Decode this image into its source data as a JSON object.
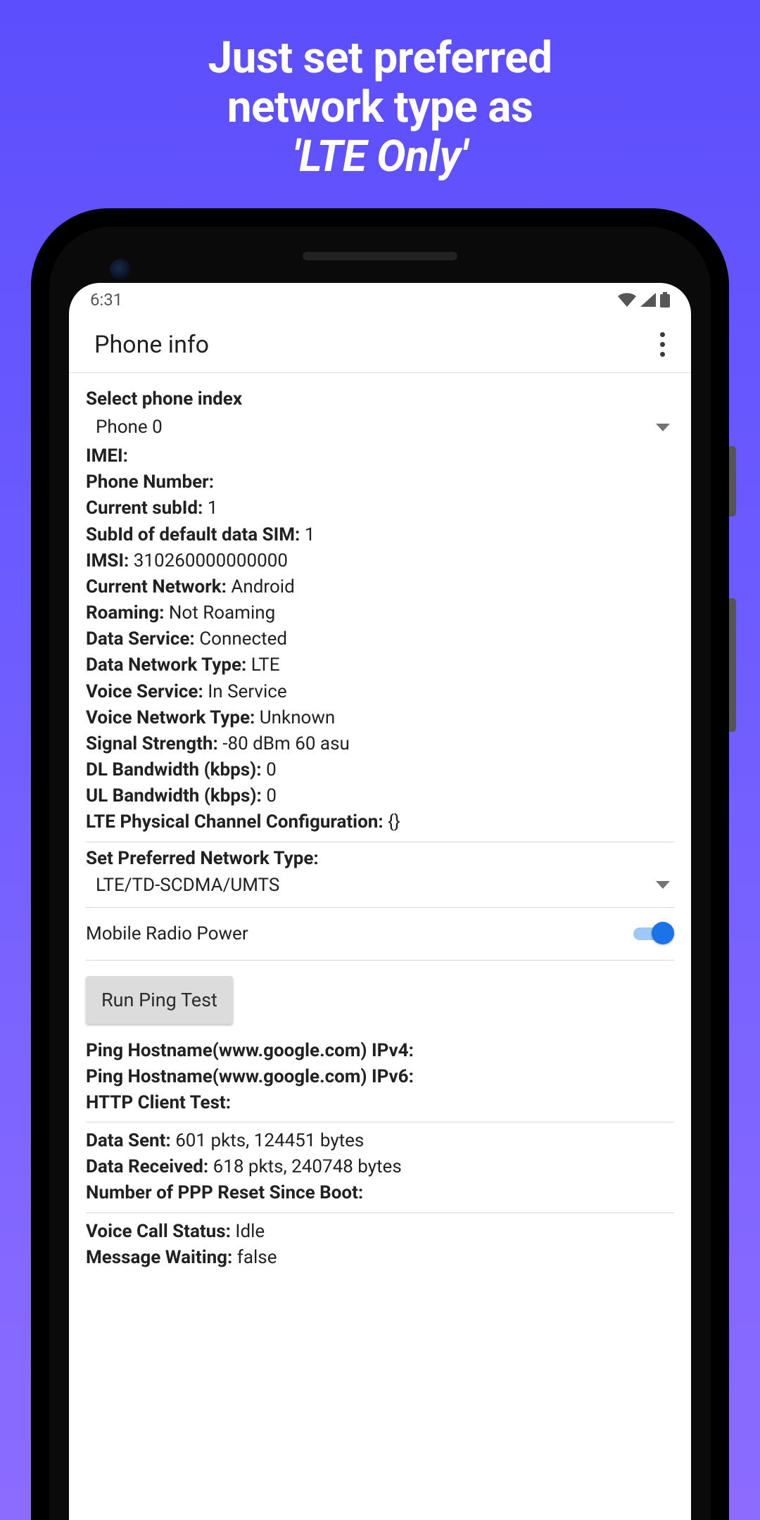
{
  "promo": {
    "line1": "Just set preferred",
    "line2": "network type as",
    "line3": "'LTE Only'"
  },
  "statusbar": {
    "time": "6:31"
  },
  "appbar": {
    "title": "Phone info"
  },
  "main": {
    "select_phone_index_label": "Select phone index",
    "phone_index_value": "Phone 0",
    "fields": {
      "imei": {
        "label": "IMEI:",
        "value": ""
      },
      "phone_number": {
        "label": "Phone Number:",
        "value": ""
      },
      "current_subid": {
        "label": "Current subId:",
        "value": "1"
      },
      "default_data_subid": {
        "label": "SubId of default data SIM:",
        "value": "1"
      },
      "imsi": {
        "label": "IMSI:",
        "value": "310260000000000"
      },
      "current_network": {
        "label": "Current Network:",
        "value": "Android"
      },
      "roaming": {
        "label": "Roaming:",
        "value": "Not Roaming"
      },
      "data_service": {
        "label": "Data Service:",
        "value": "Connected"
      },
      "data_network_type": {
        "label": "Data Network Type:",
        "value": "LTE"
      },
      "voice_service": {
        "label": "Voice Service:",
        "value": "In Service"
      },
      "voice_network_type": {
        "label": "Voice Network Type:",
        "value": "Unknown"
      },
      "signal_strength": {
        "label": "Signal Strength:",
        "value": "-80 dBm   60 asu"
      },
      "dl_bandwidth": {
        "label": "DL Bandwidth (kbps):",
        "value": "0"
      },
      "ul_bandwidth": {
        "label": "UL Bandwidth (kbps):",
        "value": "0"
      },
      "lte_phys_channel": {
        "label": "LTE Physical Channel Configuration:",
        "value": "{}"
      }
    },
    "set_pref_network_label": "Set Preferred Network Type:",
    "set_pref_network_value": "LTE/TD-SCDMA/UMTS",
    "mobile_radio_power_label": "Mobile Radio Power",
    "mobile_radio_power_on": true,
    "run_ping_test_label": "Run Ping Test",
    "ping": {
      "ipv4": {
        "label": "Ping Hostname(www.google.com) IPv4:",
        "value": ""
      },
      "ipv6": {
        "label": "Ping Hostname(www.google.com) IPv6:",
        "value": ""
      },
      "http_client_test": {
        "label": "HTTP Client Test:",
        "value": ""
      },
      "data_sent": {
        "label": "Data Sent:",
        "value": "601 pkts, 124451 bytes"
      },
      "data_received": {
        "label": "Data Received:",
        "value": "618 pkts, 240748 bytes"
      },
      "ppp_reset": {
        "label": "Number of PPP Reset Since Boot:",
        "value": ""
      },
      "voice_call_status": {
        "label": "Voice Call Status:",
        "value": "Idle"
      },
      "message_waiting": {
        "label": "Message Waiting:",
        "value": "false"
      }
    }
  }
}
